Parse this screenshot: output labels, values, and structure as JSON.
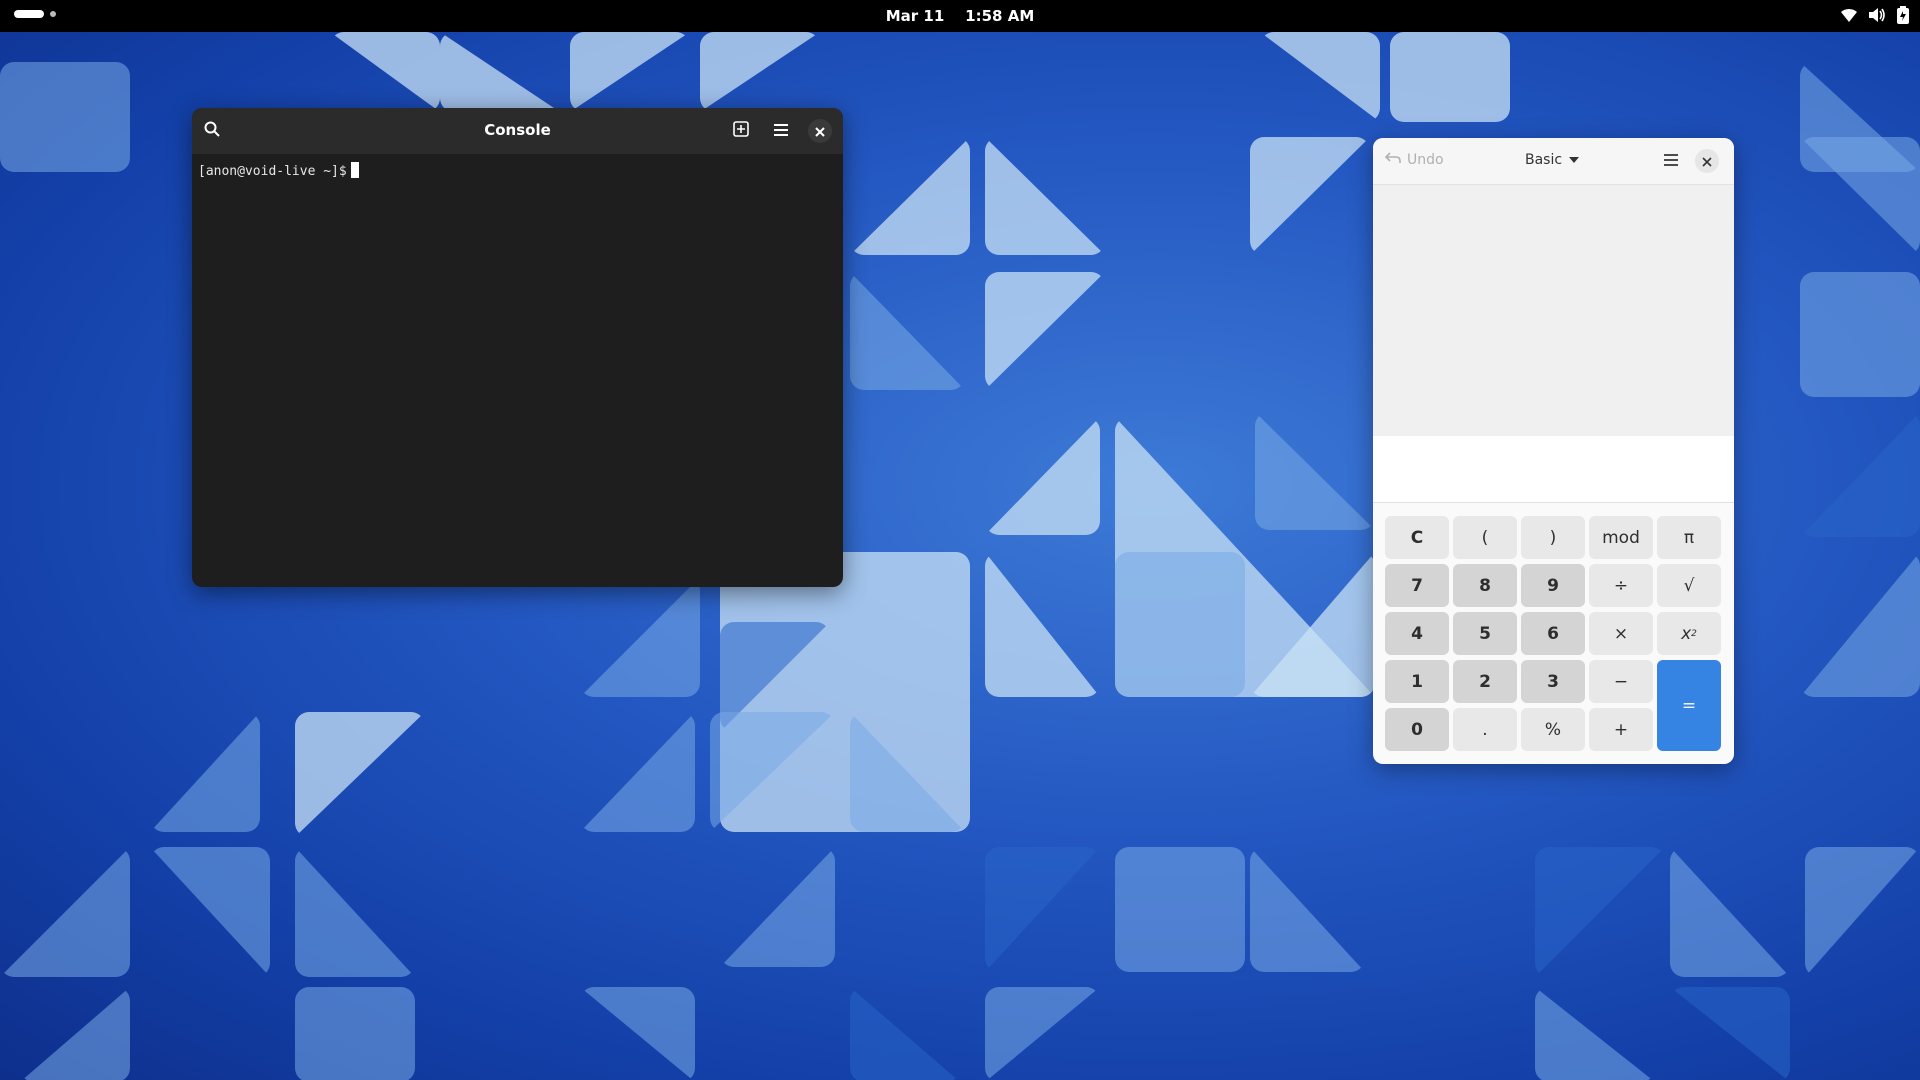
{
  "topbar": {
    "date": "Mar 11",
    "time": "1:58 AM",
    "icons": [
      "activities-indicator",
      "wifi-icon",
      "volume-icon",
      "battery-icon"
    ]
  },
  "console": {
    "title": "Console",
    "prompt": "[anon@void-live ~]$",
    "icons": [
      "search-icon",
      "new-tab-icon",
      "menu-icon",
      "close-icon"
    ]
  },
  "calculator": {
    "undo_label": "Undo",
    "mode_label": "Basic",
    "keys": {
      "clear": "C",
      "lparen": "(",
      "rparen": ")",
      "mod": "mod",
      "pi": "π",
      "seven": "7",
      "eight": "8",
      "nine": "9",
      "divide": "÷",
      "sqrt": "√",
      "four": "4",
      "five": "5",
      "six": "6",
      "multiply": "×",
      "square_base": "x",
      "square_exp": "2",
      "one": "1",
      "two": "2",
      "three": "3",
      "subtract": "−",
      "equals": "=",
      "zero": "0",
      "point": ".",
      "percent": "%",
      "add": "+"
    }
  },
  "colors": {
    "accent": "#3584e4",
    "terminal_bg": "#1e1e1e",
    "topbar_bg": "#000000"
  }
}
